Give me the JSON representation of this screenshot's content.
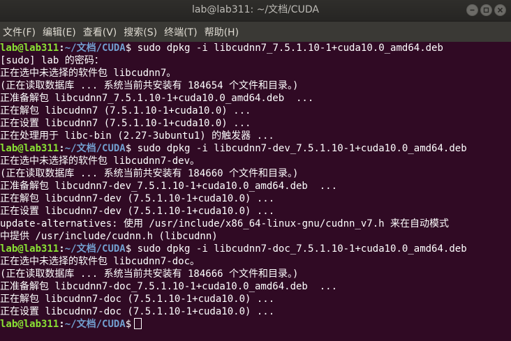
{
  "window": {
    "title": "lab@lab311: ~/文档/CUDA",
    "controls": [
      "minimize-icon",
      "maximize-icon",
      "close-icon"
    ]
  },
  "menu": [
    "文件(F)",
    "编辑(E)",
    "查看(V)",
    "搜索(S)",
    "终端(T)",
    "帮助(H)"
  ],
  "colors": {
    "terminal_bg": "#300a24",
    "user_host": "#8ae234",
    "path": "#729fcf",
    "text": "#ffffff"
  },
  "prompt": {
    "user_host": "lab@lab311",
    "sep": ":",
    "path": "~/文档/CUDA",
    "dollar": "$"
  },
  "lines": [
    {
      "type": "prompt",
      "cmd": " sudo dpkg -i libcudnn7_7.5.1.10-1+cuda10.0_amd64.deb"
    },
    {
      "type": "out",
      "text": "[sudo] lab 的密码："
    },
    {
      "type": "out",
      "text": "正在选中未选择的软件包 libcudnn7。"
    },
    {
      "type": "out",
      "text": "(正在读取数据库 ... 系统当前共安装有 184654 个文件和目录。)"
    },
    {
      "type": "out",
      "text": "正准备解包 libcudnn7_7.5.1.10-1+cuda10.0_amd64.deb  ..."
    },
    {
      "type": "out",
      "text": "正在解包 libcudnn7 (7.5.1.10-1+cuda10.0) ..."
    },
    {
      "type": "out",
      "text": "正在设置 libcudnn7 (7.5.1.10-1+cuda10.0) ..."
    },
    {
      "type": "out",
      "text": "正在处理用于 libc-bin (2.27-3ubuntu1) 的触发器 ..."
    },
    {
      "type": "prompt",
      "cmd": " sudo dpkg -i libcudnn7-dev_7.5.1.10-1+cuda10.0_amd64.deb"
    },
    {
      "type": "out",
      "text": "正在选中未选择的软件包 libcudnn7-dev。"
    },
    {
      "type": "out",
      "text": "(正在读取数据库 ... 系统当前共安装有 184660 个文件和目录。)"
    },
    {
      "type": "out",
      "text": "正准备解包 libcudnn7-dev_7.5.1.10-1+cuda10.0_amd64.deb  ..."
    },
    {
      "type": "out",
      "text": "正在解包 libcudnn7-dev (7.5.1.10-1+cuda10.0) ..."
    },
    {
      "type": "out",
      "text": "正在设置 libcudnn7-dev (7.5.1.10-1+cuda10.0) ..."
    },
    {
      "type": "out",
      "text": "update-alternatives: 使用 /usr/include/x86_64-linux-gnu/cudnn_v7.h 来在自动模式"
    },
    {
      "type": "out",
      "text": "中提供 /usr/include/cudnn.h (libcudnn)"
    },
    {
      "type": "prompt",
      "cmd": " sudo dpkg -i libcudnn7-doc_7.5.1.10-1+cuda10.0_amd64.deb"
    },
    {
      "type": "out",
      "text": "正在选中未选择的软件包 libcudnn7-doc。"
    },
    {
      "type": "out",
      "text": "(正在读取数据库 ... 系统当前共安装有 184666 个文件和目录。)"
    },
    {
      "type": "out",
      "text": "正准备解包 libcudnn7-doc_7.5.1.10-1+cuda10.0_amd64.deb  ..."
    },
    {
      "type": "out",
      "text": "正在解包 libcudnn7-doc (7.5.1.10-1+cuda10.0) ..."
    },
    {
      "type": "out",
      "text": "正在设置 libcudnn7-doc (7.5.1.10-1+cuda10.0) ..."
    },
    {
      "type": "prompt",
      "cmd": "",
      "cursor": true
    }
  ]
}
